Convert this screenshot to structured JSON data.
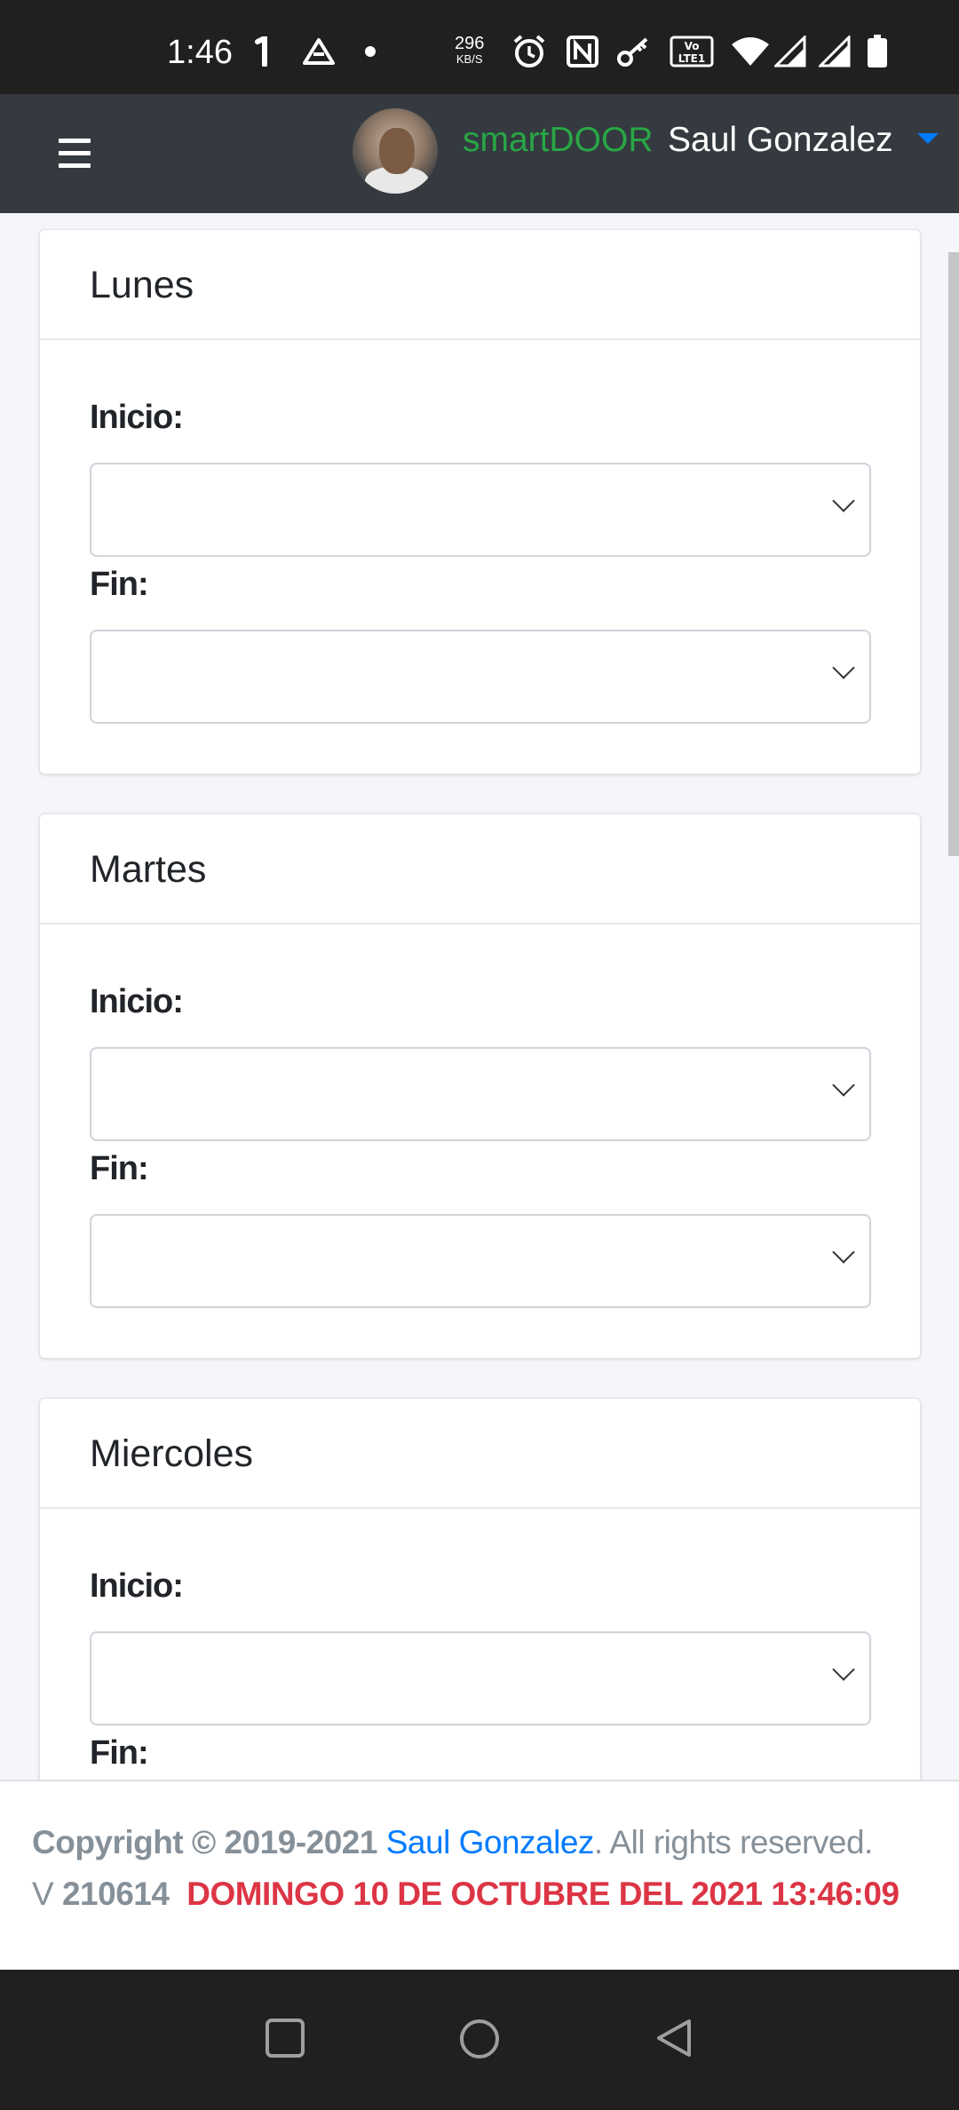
{
  "status_bar": {
    "time": "1:46",
    "net_speed_value": "296",
    "net_speed_unit": "KB/S",
    "icons": [
      "notification-icon",
      "drive-icon",
      "dot-icon",
      "alarm-icon",
      "nfc-icon",
      "key-icon",
      "volte-icon",
      "wifi-icon",
      "signal-icon",
      "signal-icon-2",
      "battery-icon"
    ]
  },
  "navbar": {
    "brand": "smartDOOR",
    "user_name": "Saul Gonzalez",
    "menu_icon": "hamburger-icon",
    "dropdown_icon": "caret-down-icon"
  },
  "days": [
    {
      "title": "Lunes",
      "start_label": "Inicio:",
      "start_value": "",
      "end_label": "Fin:",
      "end_value": ""
    },
    {
      "title": "Martes",
      "start_label": "Inicio:",
      "start_value": "",
      "end_label": "Fin:",
      "end_value": ""
    },
    {
      "title": "Miercoles",
      "start_label": "Inicio:",
      "start_value": "",
      "end_label": "Fin:",
      "end_value": ""
    }
  ],
  "footer": {
    "copyright_prefix": "Copyright © 2019-2021 ",
    "author": "Saul Gonzalez",
    "copyright_suffix": ". All rights reserved.",
    "version_label": "V",
    "version": "210614",
    "datetime": "DOMINGO 10 DE OCTUBRE DEL 2021 13:46:09"
  },
  "system_nav": {
    "recents": "square-icon",
    "home": "circle-icon",
    "back": "triangle-back-icon"
  },
  "colors": {
    "brand": "#28a745",
    "navbar": "#343a40",
    "link": "#007bff",
    "date": "#dc3545"
  }
}
